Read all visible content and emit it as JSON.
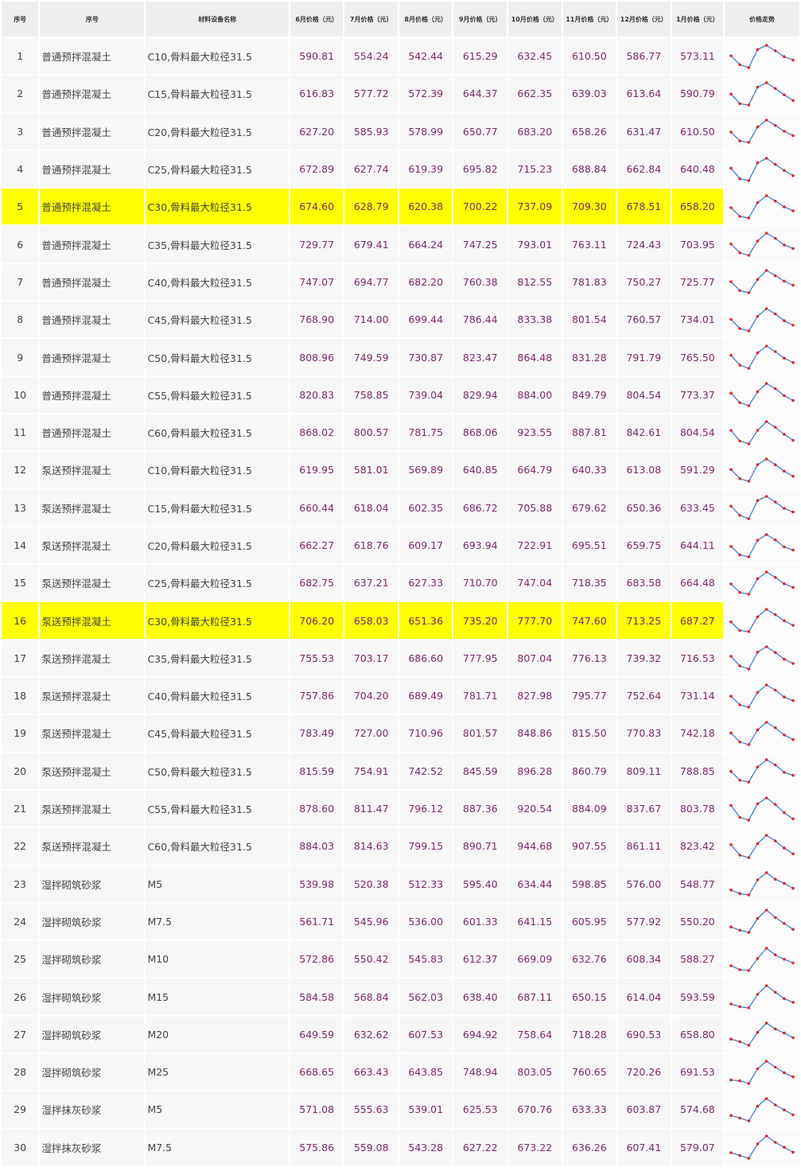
{
  "headers": [
    "序号",
    "序号",
    "材料设备名称",
    "6月价格（元）",
    "7月价格（元）",
    "8月价格（元）",
    "9月价格（元）",
    "10月价格（元）",
    "11月价格（元）",
    "12月价格（元）",
    "1月价格（元）",
    "价格走势"
  ],
  "colors": {
    "highlight": "#ffff00",
    "price_text": "#7d2a6b",
    "sparkline_line": "#4a7fc1",
    "sparkline_point": "#d9292f"
  },
  "rows": [
    {
      "idx": "1",
      "name": "普通预拌混凝土",
      "spec": "C10,骨料最大粒径31.5",
      "prices": [
        "590.81",
        "554.24",
        "542.44",
        "615.29",
        "632.45",
        "610.50",
        "586.77",
        "573.11"
      ],
      "highlight": false
    },
    {
      "idx": "2",
      "name": "普通预拌混凝土",
      "spec": "C15,骨料最大粒径31.5",
      "prices": [
        "616.83",
        "577.72",
        "572.39",
        "644.37",
        "662.35",
        "639.03",
        "613.64",
        "590.79"
      ],
      "highlight": false
    },
    {
      "idx": "3",
      "name": "普通预拌混凝土",
      "spec": "C20,骨料最大粒径31.5",
      "prices": [
        "627.20",
        "585.93",
        "578.99",
        "650.77",
        "683.20",
        "658.26",
        "631.47",
        "610.50"
      ],
      "highlight": false
    },
    {
      "idx": "4",
      "name": "普通预拌混凝土",
      "spec": "C25,骨料最大粒径31.5",
      "prices": [
        "672.89",
        "627.74",
        "619.39",
        "695.82",
        "715.23",
        "688.84",
        "662.84",
        "640.48"
      ],
      "highlight": false
    },
    {
      "idx": "5",
      "name": "普通预拌混凝土",
      "spec": "C30,骨料最大粒径31.5",
      "prices": [
        "674.60",
        "628.79",
        "620.38",
        "700.22",
        "737.09",
        "709.30",
        "678.51",
        "658.20"
      ],
      "highlight": true
    },
    {
      "idx": "6",
      "name": "普通预拌混凝土",
      "spec": "C35,骨料最大粒径31.5",
      "prices": [
        "729.77",
        "679.41",
        "664.24",
        "747.25",
        "793.01",
        "763.11",
        "724.43",
        "703.95"
      ],
      "highlight": false
    },
    {
      "idx": "7",
      "name": "普通预拌混凝土",
      "spec": "C40,骨料最大粒径31.5",
      "prices": [
        "747.07",
        "694.77",
        "682.20",
        "760.38",
        "812.55",
        "781.83",
        "750.27",
        "725.77"
      ],
      "highlight": false
    },
    {
      "idx": "8",
      "name": "普通预拌混凝土",
      "spec": "C45,骨料最大粒径31.5",
      "prices": [
        "768.90",
        "714.00",
        "699.44",
        "786.44",
        "833.38",
        "801.54",
        "760.57",
        "734.01"
      ],
      "highlight": false
    },
    {
      "idx": "9",
      "name": "普通预拌混凝土",
      "spec": "C50,骨料最大粒径31.5",
      "prices": [
        "808.96",
        "749.59",
        "730.87",
        "823.47",
        "864.48",
        "831.28",
        "791.79",
        "765.50"
      ],
      "highlight": false
    },
    {
      "idx": "10",
      "name": "普通预拌混凝土",
      "spec": "C55,骨料最大粒径31.5",
      "prices": [
        "820.83",
        "758.85",
        "739.04",
        "829.94",
        "884.00",
        "849.79",
        "804.54",
        "773.37"
      ],
      "highlight": false
    },
    {
      "idx": "11",
      "name": "普通预拌混凝土",
      "spec": "C60,骨料最大粒径31.5",
      "prices": [
        "868.02",
        "800.57",
        "781.75",
        "868.06",
        "923.55",
        "887.81",
        "842.61",
        "804.54"
      ],
      "highlight": false
    },
    {
      "idx": "12",
      "name": "泵送预拌混凝土",
      "spec": "C10,骨料最大粒径31.5",
      "prices": [
        "619.95",
        "581.01",
        "569.89",
        "640.85",
        "664.79",
        "640.33",
        "613.08",
        "591.29"
      ],
      "highlight": false
    },
    {
      "idx": "13",
      "name": "泵送预拌混凝土",
      "spec": "C15,骨料最大粒径31.5",
      "prices": [
        "660.44",
        "618.04",
        "602.35",
        "686.72",
        "705.88",
        "679.62",
        "650.36",
        "633.45"
      ],
      "highlight": false
    },
    {
      "idx": "14",
      "name": "泵送预拌混凝土",
      "spec": "C20,骨料最大粒径31.5",
      "prices": [
        "662.27",
        "618.76",
        "609.17",
        "693.94",
        "722.91",
        "695.51",
        "659.75",
        "644.11"
      ],
      "highlight": false
    },
    {
      "idx": "15",
      "name": "泵送预拌混凝土",
      "spec": "C25,骨料最大粒径31.5",
      "prices": [
        "682.75",
        "637.21",
        "627.33",
        "710.70",
        "747.04",
        "718.35",
        "683.58",
        "664.48"
      ],
      "highlight": false
    },
    {
      "idx": "16",
      "name": "泵送预拌混凝土",
      "spec": "C30,骨料最大粒径31.5",
      "prices": [
        "706.20",
        "658.03",
        "651.36",
        "735.20",
        "777.70",
        "747.60",
        "713.25",
        "687.27"
      ],
      "highlight": true
    },
    {
      "idx": "17",
      "name": "泵送预拌混凝土",
      "spec": "C35,骨料最大粒径31.5",
      "prices": [
        "755.53",
        "703.17",
        "686.60",
        "777.95",
        "807.04",
        "776.13",
        "739.32",
        "716.53"
      ],
      "highlight": false
    },
    {
      "idx": "18",
      "name": "泵送预拌混凝土",
      "spec": "C40,骨料最大粒径31.5",
      "prices": [
        "757.86",
        "704.20",
        "689.49",
        "781.71",
        "827.98",
        "795.77",
        "752.64",
        "731.14"
      ],
      "highlight": false
    },
    {
      "idx": "19",
      "name": "泵送预拌混凝土",
      "spec": "C45,骨料最大粒径31.5",
      "prices": [
        "783.49",
        "727.00",
        "710.96",
        "801.57",
        "848.86",
        "815.50",
        "770.83",
        "742.18"
      ],
      "highlight": false
    },
    {
      "idx": "20",
      "name": "泵送预拌混凝土",
      "spec": "C50,骨料最大粒径31.5",
      "prices": [
        "815.59",
        "754.91",
        "742.52",
        "845.59",
        "896.28",
        "860.79",
        "809.11",
        "788.85"
      ],
      "highlight": false
    },
    {
      "idx": "21",
      "name": "泵送预拌混凝土",
      "spec": "C55,骨料最大粒径31.5",
      "prices": [
        "878.60",
        "811.47",
        "796.12",
        "887.36",
        "920.54",
        "884.09",
        "837.67",
        "803.78"
      ],
      "highlight": false
    },
    {
      "idx": "22",
      "name": "泵送预拌混凝土",
      "spec": "C60,骨料最大粒径31.5",
      "prices": [
        "884.03",
        "814.63",
        "799.15",
        "890.71",
        "944.68",
        "907.55",
        "861.11",
        "823.42"
      ],
      "highlight": false
    },
    {
      "idx": "23",
      "name": "湿拌砌筑砂浆",
      "spec": "M5",
      "prices": [
        "539.98",
        "520.38",
        "512.33",
        "595.40",
        "634.44",
        "598.85",
        "576.00",
        "548.77"
      ],
      "highlight": false
    },
    {
      "idx": "24",
      "name": "湿拌砌筑砂浆",
      "spec": "M7.5",
      "prices": [
        "561.71",
        "545.96",
        "536.00",
        "601.33",
        "641.15",
        "605.95",
        "577.92",
        "550.20"
      ],
      "highlight": false
    },
    {
      "idx": "25",
      "name": "湿拌砌筑砂浆",
      "spec": "M10",
      "prices": [
        "572.86",
        "550.42",
        "545.83",
        "612.37",
        "669.09",
        "632.76",
        "608.34",
        "588.27"
      ],
      "highlight": false
    },
    {
      "idx": "26",
      "name": "湿拌砌筑砂浆",
      "spec": "M15",
      "prices": [
        "584.58",
        "568.84",
        "562.03",
        "638.40",
        "687.11",
        "650.15",
        "614.04",
        "593.59"
      ],
      "highlight": false
    },
    {
      "idx": "27",
      "name": "湿拌砌筑砂浆",
      "spec": "M20",
      "prices": [
        "649.59",
        "632.62",
        "607.53",
        "694.92",
        "758.64",
        "718.28",
        "690.53",
        "658.80"
      ],
      "highlight": false
    },
    {
      "idx": "28",
      "name": "湿拌砌筑砂浆",
      "spec": "M25",
      "prices": [
        "668.65",
        "663.43",
        "643.85",
        "748.94",
        "803.05",
        "760.65",
        "720.26",
        "691.53"
      ],
      "highlight": false
    },
    {
      "idx": "29",
      "name": "湿拌抹灰砂浆",
      "spec": "M5",
      "prices": [
        "571.08",
        "555.63",
        "539.01",
        "625.53",
        "670.76",
        "633.33",
        "603.87",
        "574.68"
      ],
      "highlight": false
    },
    {
      "idx": "30",
      "name": "湿拌抹灰砂浆",
      "spec": "M7.5",
      "prices": [
        "575.86",
        "559.08",
        "543.28",
        "627.22",
        "673.22",
        "636.26",
        "607.41",
        "579.07"
      ],
      "highlight": false
    }
  ]
}
